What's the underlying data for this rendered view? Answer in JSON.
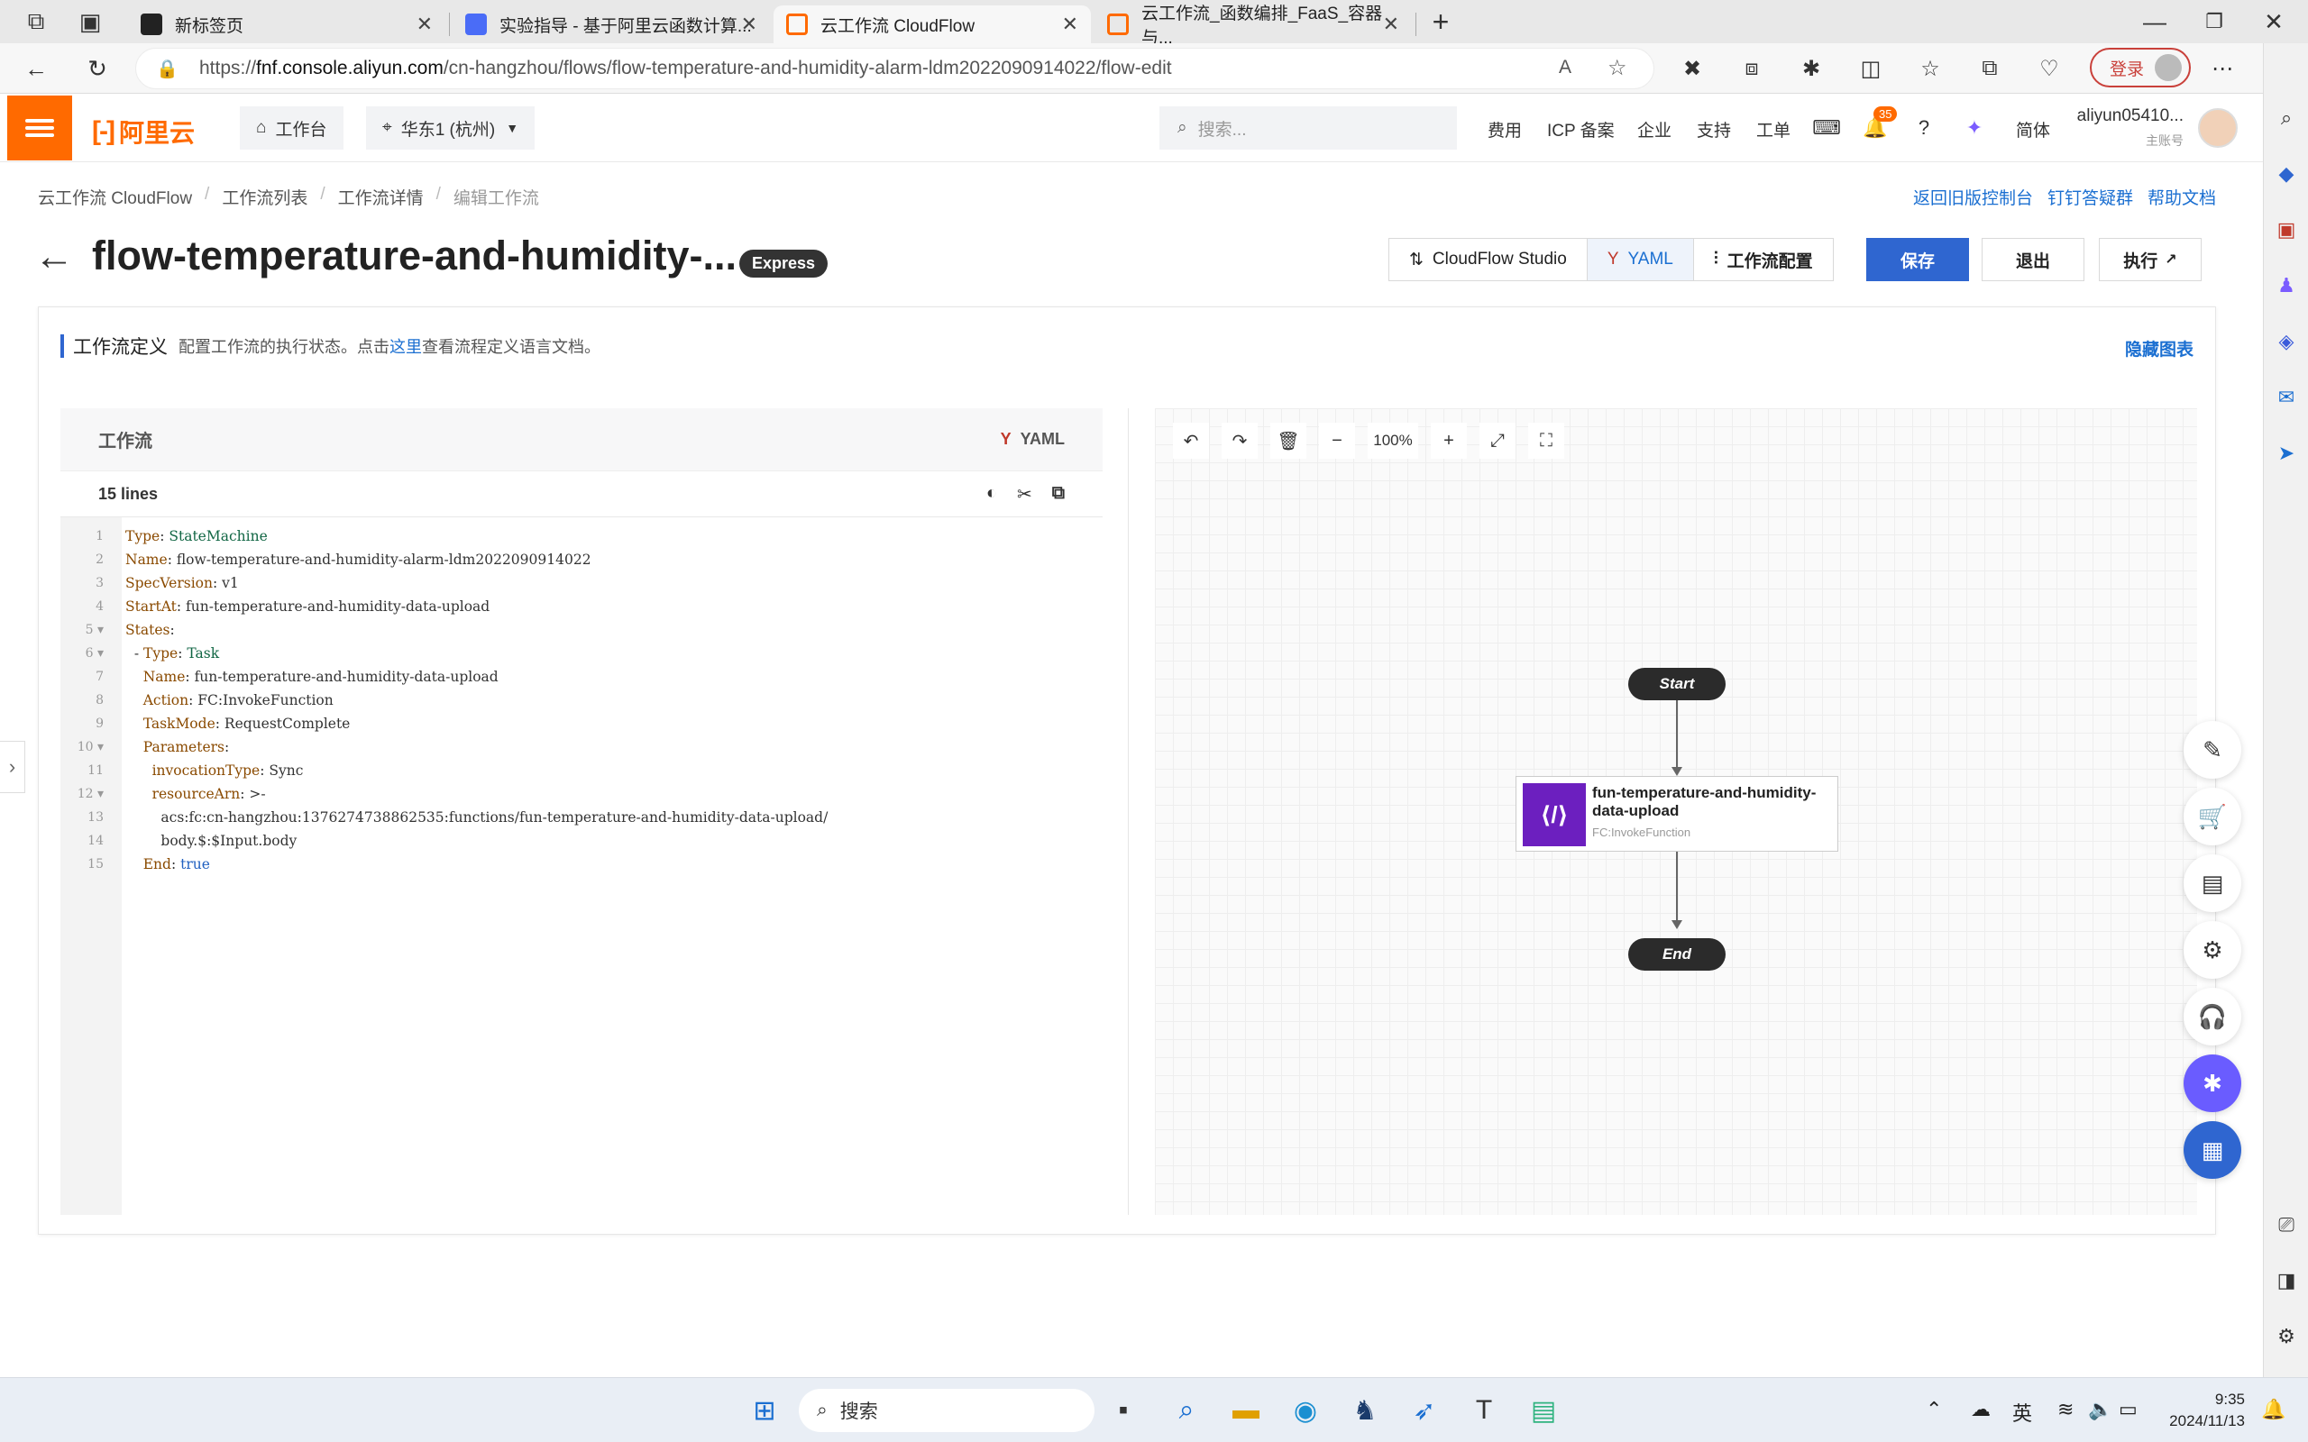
{
  "browser": {
    "tabs": [
      {
        "title": "新标签页",
        "color": "#222222"
      },
      {
        "title": "实验指导 - 基于阿里云函数计算...",
        "color": "#4a6cf7"
      },
      {
        "title": "云工作流 CloudFlow",
        "color": "#ff6a00"
      },
      {
        "title": "云工作流_函数编排_FaaS_容器与...",
        "color": "#ff6a00"
      }
    ],
    "url_prefix": "https://",
    "url_host": "fnf.console.aliyun.com",
    "url_path": "/cn-hangzhou/flows/flow-temperature-and-humidity-alarm-ldm2022090914022/flow-edit",
    "login_label": "登录"
  },
  "header": {
    "logo_text": "阿里云",
    "workbench": "工作台",
    "region": "华东1 (杭州)",
    "search_placeholder": "搜索...",
    "links": [
      "费用",
      "ICP 备案",
      "企业",
      "支持",
      "工单"
    ],
    "notification_count": "35",
    "lang": "简体",
    "account_name": "aliyun05410...",
    "account_role": "主账号"
  },
  "breadcrumb": [
    "云工作流 CloudFlow",
    "工作流列表",
    "工作流详情",
    "编辑工作流"
  ],
  "top_links": [
    "返回旧版控制台",
    "钉钉答疑群",
    "帮助文档"
  ],
  "page": {
    "title": "flow-temperature-and-humidity-...",
    "tag": "Express",
    "tool_buttons": [
      "CloudFlow Studio",
      "YAML",
      "工作流配置"
    ],
    "save": "保存",
    "exit": "退出",
    "run": "执行"
  },
  "definition": {
    "heading": "工作流定义",
    "desc_before": "配置工作流的执行状态。点击",
    "desc_link": "这里",
    "desc_after": "查看流程定义语言文档。",
    "hide_chart": "隐藏图表"
  },
  "editor": {
    "panel_title": "工作流",
    "format": "YAML",
    "lines_label": "15 lines",
    "code": [
      [
        {
          "k": "Type"
        },
        {
          "p": ": "
        },
        {
          "s": "StateMachine"
        }
      ],
      [
        {
          "k": "Name"
        },
        {
          "p": ": "
        },
        {
          "v": "flow-temperature-and-humidity-alarm-ldm2022090914022"
        }
      ],
      [
        {
          "k": "SpecVersion"
        },
        {
          "p": ": "
        },
        {
          "v": "v1"
        }
      ],
      [
        {
          "k": "StartAt"
        },
        {
          "p": ": "
        },
        {
          "v": "fun-temperature-and-humidity-data-upload"
        }
      ],
      [
        {
          "k": "States"
        },
        {
          "p": ":"
        }
      ],
      [
        {
          "p": "  - "
        },
        {
          "k": "Type"
        },
        {
          "p": ": "
        },
        {
          "s": "Task"
        }
      ],
      [
        {
          "p": "    "
        },
        {
          "k": "Name"
        },
        {
          "p": ": "
        },
        {
          "v": "fun-temperature-and-humidity-data-upload"
        }
      ],
      [
        {
          "p": "    "
        },
        {
          "k": "Action"
        },
        {
          "p": ": "
        },
        {
          "v": "FC:InvokeFunction"
        }
      ],
      [
        {
          "p": "    "
        },
        {
          "k": "TaskMode"
        },
        {
          "p": ": "
        },
        {
          "v": "RequestComplete"
        }
      ],
      [
        {
          "p": "    "
        },
        {
          "k": "Parameters"
        },
        {
          "p": ":"
        }
      ],
      [
        {
          "p": "      "
        },
        {
          "k": "invocationType"
        },
        {
          "p": ": "
        },
        {
          "v": "Sync"
        }
      ],
      [
        {
          "p": "      "
        },
        {
          "k": "resourceArn"
        },
        {
          "p": ": >-"
        }
      ],
      [
        {
          "p": "        "
        },
        {
          "v": "acs:fc:cn-hangzhou:1376274738862535:functions/fun-temperature-and-humidity-data-upload/"
        }
      ],
      [
        {
          "p": "        "
        },
        {
          "v": "body.$:$Input.body"
        }
      ],
      [
        {
          "p": "    "
        },
        {
          "k": "End"
        },
        {
          "p": ": "
        },
        {
          "t": "true"
        }
      ]
    ],
    "fold_lines": [
      5,
      6,
      10,
      12
    ]
  },
  "canvas": {
    "zoom": "100%",
    "start_label": "Start",
    "end_label": "End",
    "task_title": "fun-temperature-and-humidity-data-upload",
    "task_type": "FC:InvokeFunction"
  },
  "taskbar": {
    "search_label": "搜索",
    "ime": "英",
    "time": "9:35",
    "date": "2024/11/13"
  },
  "colors": {
    "brand": "#ff6a00",
    "primary": "#2f66d0",
    "link": "#1b6fd1"
  }
}
